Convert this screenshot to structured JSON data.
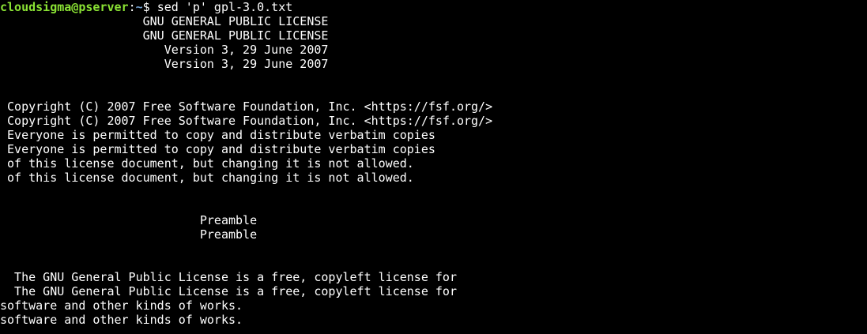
{
  "colors": {
    "background": "#000000",
    "text": "#ffffff",
    "prompt_user": "#8ae234",
    "prompt_path": "#729fcf"
  },
  "prompt": {
    "user_host": "cloudsigma@pserver",
    "separator": ":",
    "path": "~",
    "symbol": "$ ",
    "command": "sed 'p' gpl-3.0.txt"
  },
  "output_lines": [
    "                    GNU GENERAL PUBLIC LICENSE",
    "                    GNU GENERAL PUBLIC LICENSE",
    "                       Version 3, 29 June 2007",
    "                       Version 3, 29 June 2007",
    "",
    "",
    " Copyright (C) 2007 Free Software Foundation, Inc. <https://fsf.org/>",
    " Copyright (C) 2007 Free Software Foundation, Inc. <https://fsf.org/>",
    " Everyone is permitted to copy and distribute verbatim copies",
    " Everyone is permitted to copy and distribute verbatim copies",
    " of this license document, but changing it is not allowed.",
    " of this license document, but changing it is not allowed.",
    "",
    "",
    "                            Preamble",
    "                            Preamble",
    "",
    "",
    "  The GNU General Public License is a free, copyleft license for",
    "  The GNU General Public License is a free, copyleft license for",
    "software and other kinds of works.",
    "software and other kinds of works."
  ]
}
